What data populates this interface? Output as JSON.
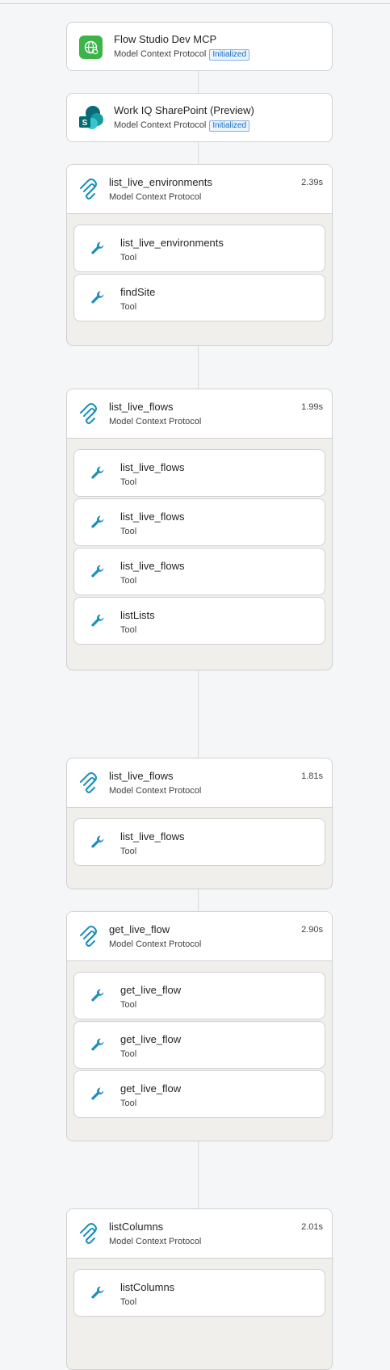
{
  "servers": [
    {
      "name": "Flow Studio Dev MCP",
      "protocol": "Model Context Protocol",
      "status": "Initialized",
      "icon": "globe-icon"
    },
    {
      "name": "Work IQ SharePoint (Preview)",
      "protocol": "Model Context Protocol",
      "status": "Initialized",
      "icon": "sharepoint-icon"
    }
  ],
  "groups": [
    {
      "title": "list_live_environments",
      "protocol": "Model Context Protocol",
      "duration": "2.39s",
      "tools": [
        {
          "name": "list_live_environments",
          "type": "Tool"
        },
        {
          "name": "findSite",
          "type": "Tool"
        }
      ]
    },
    {
      "title": "list_live_flows",
      "protocol": "Model Context Protocol",
      "duration": "1.99s",
      "tools": [
        {
          "name": "list_live_flows",
          "type": "Tool"
        },
        {
          "name": "list_live_flows",
          "type": "Tool"
        },
        {
          "name": "list_live_flows",
          "type": "Tool"
        },
        {
          "name": "listLists",
          "type": "Tool"
        }
      ]
    },
    {
      "title": "list_live_flows",
      "protocol": "Model Context Protocol",
      "duration": "1.81s",
      "tools": [
        {
          "name": "list_live_flows",
          "type": "Tool"
        }
      ]
    },
    {
      "title": "get_live_flow",
      "protocol": "Model Context Protocol",
      "duration": "2.90s",
      "tools": [
        {
          "name": "get_live_flow",
          "type": "Tool"
        },
        {
          "name": "get_live_flow",
          "type": "Tool"
        },
        {
          "name": "get_live_flow",
          "type": "Tool"
        }
      ]
    },
    {
      "title": "listColumns",
      "protocol": "Model Context Protocol",
      "duration": "2.01s",
      "tools": [
        {
          "name": "listColumns",
          "type": "Tool"
        }
      ]
    }
  ],
  "colors": {
    "accent": "#1b8fbd",
    "mcp_green": "#3bb54a",
    "badge_blue": "#0f6cbd"
  }
}
